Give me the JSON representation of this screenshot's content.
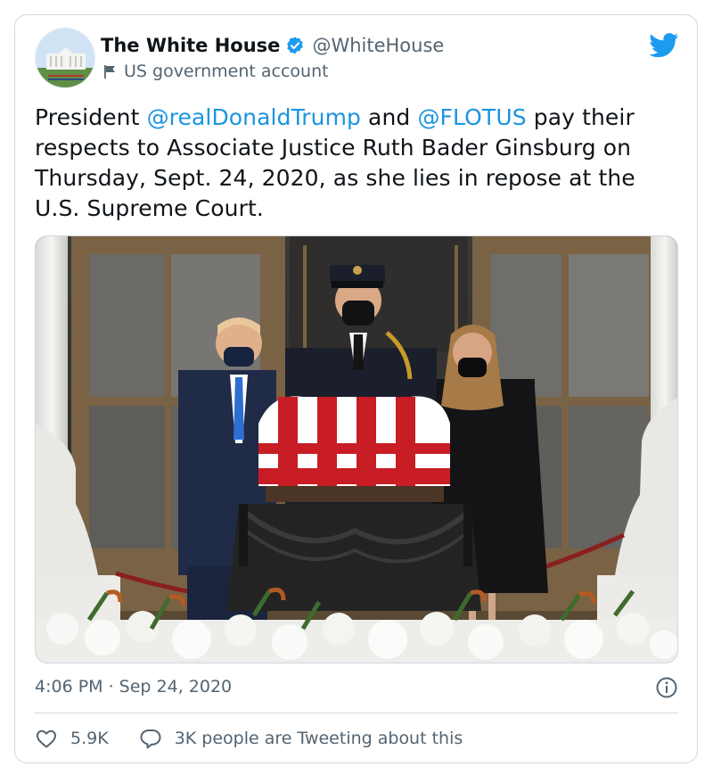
{
  "author": {
    "name": "The White House",
    "handle": "@WhiteHouse",
    "label": "US government account"
  },
  "tweet": {
    "t1": "President ",
    "m1": "@realDonaldTrump",
    "t2": " and ",
    "m2": "@FLOTUS",
    "t3": " pay their respects to Associate Justice Ruth Bader Ginsburg on Thursday, Sept. 24, 2020, as she lies in repose at the U.S. Supreme Court."
  },
  "meta": {
    "timestamp": "4:06 PM · Sep 24, 2020"
  },
  "actions": {
    "likes": "5.9K",
    "tweeting": "3K people are Tweeting about this"
  },
  "colors": {
    "link": "#1b95e0",
    "verified": "#1d9bf0",
    "secondary": "#536471"
  },
  "icons": [
    "verified-badge-icon",
    "flag-icon",
    "twitter-bird-icon",
    "info-icon",
    "heart-icon",
    "comment-icon"
  ]
}
